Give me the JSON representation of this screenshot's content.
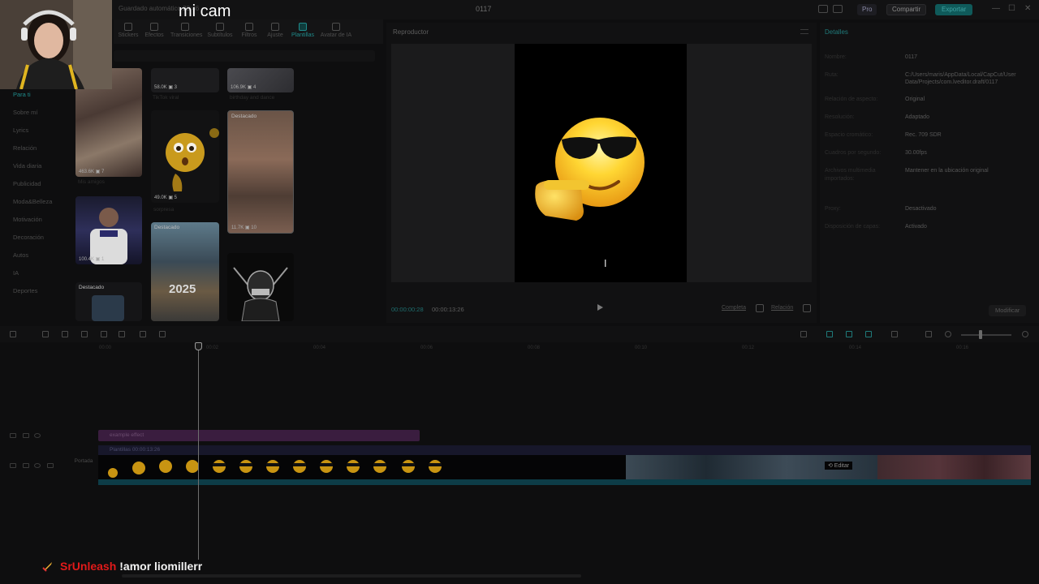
{
  "overlay": {
    "cam_label": "mi cam"
  },
  "topbar": {
    "autosave": "Guardado automático 23:46",
    "project_title": "0117",
    "pro_label": "Pro",
    "share_label": "Compartir",
    "export_label": "Exportar",
    "minimize": "—",
    "maximize": "☐",
    "close": "✕"
  },
  "toolbar": {
    "items": [
      {
        "label": "Stickers",
        "active": false
      },
      {
        "label": "Efectos",
        "active": false
      },
      {
        "label": "Transiciones",
        "active": false
      },
      {
        "label": "Subtítulos",
        "active": false
      },
      {
        "label": "Filtros",
        "active": false
      },
      {
        "label": "Ajuste",
        "active": false
      },
      {
        "label": "Plantillas",
        "active": true
      },
      {
        "label": "Avatar de IA",
        "active": false
      }
    ]
  },
  "sidebar": {
    "items": [
      {
        "label": "Para ti",
        "active": true
      },
      {
        "label": "Sobre mí",
        "active": false
      },
      {
        "label": "Lyrics",
        "active": false
      },
      {
        "label": "Relación",
        "active": false
      },
      {
        "label": "Vida diaria",
        "active": false
      },
      {
        "label": "Publicidad",
        "active": false
      },
      {
        "label": "Moda&Belleza",
        "active": false
      },
      {
        "label": "Motivación",
        "active": false
      },
      {
        "label": "Decoración",
        "active": false
      },
      {
        "label": "Autos",
        "active": false
      },
      {
        "label": "IA",
        "active": false
      },
      {
        "label": "Deportes",
        "active": false
      }
    ]
  },
  "templates": {
    "cards": [
      {
        "meta": "58.0K  ▣ 3"
      },
      {
        "meta": "106.9K  ▣ 4"
      },
      {
        "meta": "463.6K  ▣ 7",
        "caption": "Mis amigos"
      },
      {
        "meta": "49.0K  ▣ 5",
        "caption": "sorpresa"
      },
      {
        "badge": "Destacado",
        "meta": "11.7K  ▣ 10"
      },
      {
        "meta": "100.4K  ▣ 1"
      },
      {
        "badge": "Destacado",
        "year": "2025"
      },
      {
        "badge": "Destacado"
      }
    ],
    "captions": [
      "TikTok viral",
      "birthday and dance"
    ]
  },
  "player": {
    "title": "Reproductor",
    "current_time": "00:00:00:28",
    "total_time": "00:00:13:26",
    "ratio_button": "Completa",
    "relation_button": "Relación",
    "cursor_glyph": "I"
  },
  "details": {
    "title": "Detalles",
    "rows": [
      {
        "label": "Nombre:",
        "value": "0117"
      },
      {
        "label": "Ruta:",
        "value": "C:/Users/maris/AppData/Local/CapCut/User Data/Projects/com.lveditor.draft/0117"
      },
      {
        "label": "Relación de aspecto:",
        "value": "Original"
      },
      {
        "label": "Resolución:",
        "value": "Adaptado"
      },
      {
        "label": "Espacio cromático:",
        "value": "Rec. 709 SDR"
      },
      {
        "label": "Cuadros por segundo:",
        "value": "30.00fps"
      },
      {
        "label": "Archivos multimedia importados:",
        "value": "Mantener en la ubicación original"
      },
      {
        "label": "Proxy:",
        "value": "Desactivado"
      },
      {
        "label": "Disposición de capas:",
        "value": "Activado"
      }
    ],
    "modify_label": "Modificar"
  },
  "timeline": {
    "ruler_ticks": [
      "00:00",
      "00:02",
      "00:04",
      "00:06",
      "00:08",
      "00:10",
      "00:12",
      "00:14",
      "00:16"
    ],
    "effect_label": "example effect",
    "clip_label": "Plantillas   00:00:13:26",
    "cover_label": "Portada",
    "edit_label": "⟲  Editar"
  },
  "chat": {
    "username": "SrUnleash",
    "message": "!amor liomillerr"
  }
}
